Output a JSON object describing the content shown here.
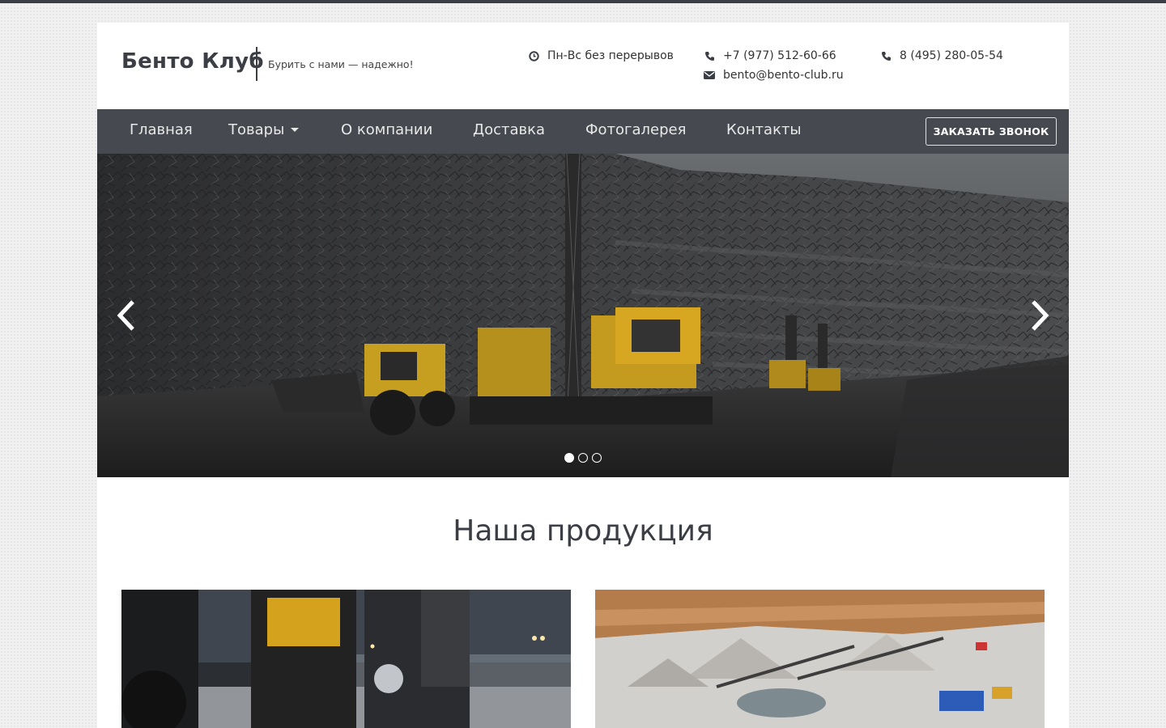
{
  "header": {
    "logo": "Бенто Клуб",
    "slogan": "Бурить с нами — надежно!",
    "hours": "Пн-Вс без перерывов",
    "phone1": "+7 (977) 512-60-66",
    "email": "bento@bento-club.ru",
    "phone2": "8 (495) 280-05-54",
    "icons": {
      "hours": "clock-icon",
      "phone": "phone-icon",
      "email": "envelope-icon"
    }
  },
  "nav": {
    "items": [
      {
        "label": "Главная"
      },
      {
        "label": "Товары",
        "has_dropdown": true
      },
      {
        "label": "О компании"
      },
      {
        "label": "Доставка"
      },
      {
        "label": "Фотогалерея"
      },
      {
        "label": "Контакты"
      }
    ],
    "cta": "ЗАКАЗАТЬ ЗВОНОК"
  },
  "slider": {
    "slide_count": 3,
    "active_slide": 1
  },
  "products": {
    "title": "Наша продукция"
  },
  "colors": {
    "nav_bg": "#464950",
    "text_dark": "#3b3e45",
    "accent_yellow": "#d8a722"
  }
}
